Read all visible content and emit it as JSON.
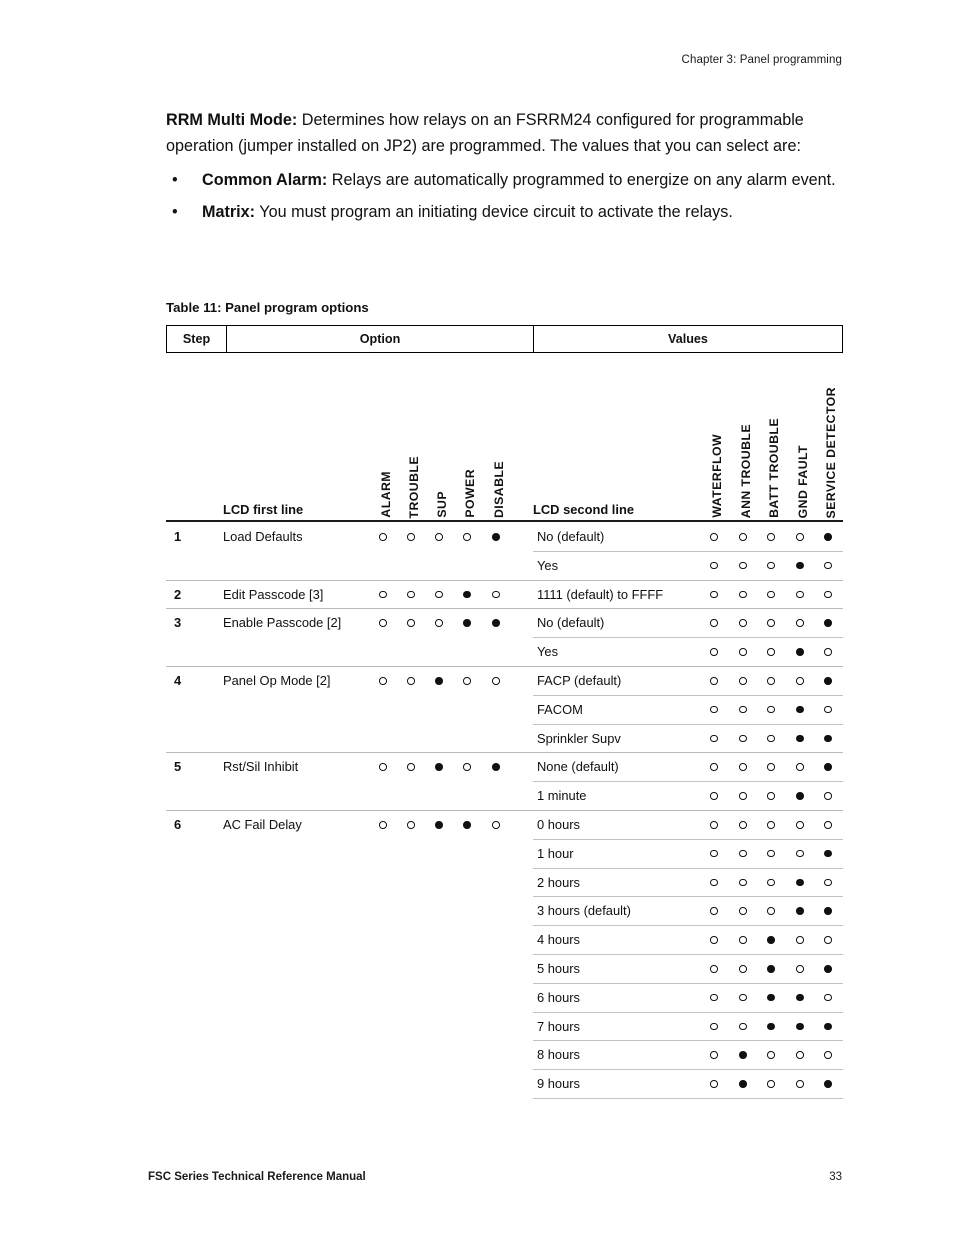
{
  "header": {
    "running_head": "Chapter 3: Panel programming"
  },
  "body": {
    "intro": {
      "lead": "RRM Multi Mode:",
      "text": " Determines how relays on an FSRRM24 configured for programmable operation (jumper installed on JP2) are programmed. The values that you can select are:"
    },
    "bullet_marker": "•",
    "bullets": [
      {
        "lead": "Common Alarm:",
        "text": " Relays are automatically programmed to energize on any alarm event."
      },
      {
        "lead": "Matrix:",
        "text": " You must program an initiating device circuit to activate the relays."
      }
    ]
  },
  "table": {
    "caption": "Table 11: Panel program options",
    "header": {
      "step": "Step",
      "option": "Option",
      "values": "Values"
    },
    "subheader": {
      "lcd_first": "LCD first line",
      "lcd_second": "LCD second line"
    },
    "option_bits": [
      "ALARM",
      "TROUBLE",
      "SUP",
      "POWER",
      "DISABLE"
    ],
    "value_bits": [
      "WATERFLOW",
      "ANN TROUBLE",
      "BATT TROUBLE",
      "GND FAULT",
      "SERVICE DETECTOR"
    ],
    "legend": {
      "open": "open circle (off)",
      "filled": "filled circle (on)"
    },
    "groups": [
      {
        "step": "1",
        "option": "Load Defaults",
        "option_leds": [
          0,
          0,
          0,
          0,
          1
        ],
        "values": [
          {
            "label": "No (default)",
            "leds": [
              0,
              0,
              0,
              0,
              1
            ]
          },
          {
            "label": "Yes",
            "leds": [
              0,
              0,
              0,
              1,
              0
            ]
          }
        ]
      },
      {
        "step": "2",
        "option": "Edit Passcode [3]",
        "option_leds": [
          0,
          0,
          0,
          1,
          0
        ],
        "values": [
          {
            "label": "1111 (default) to FFFF",
            "leds": [
              0,
              0,
              0,
              0,
              0
            ]
          }
        ]
      },
      {
        "step": "3",
        "option": "Enable Passcode [2]",
        "option_leds": [
          0,
          0,
          0,
          1,
          1
        ],
        "values": [
          {
            "label": "No (default)",
            "leds": [
              0,
              0,
              0,
              0,
              1
            ]
          },
          {
            "label": "Yes",
            "leds": [
              0,
              0,
              0,
              1,
              0
            ]
          }
        ]
      },
      {
        "step": "4",
        "option": "Panel Op Mode [2]",
        "option_leds": [
          0,
          0,
          1,
          0,
          0
        ],
        "values": [
          {
            "label": "FACP (default)",
            "leds": [
              0,
              0,
              0,
              0,
              1
            ]
          },
          {
            "label": "FACOM",
            "leds": [
              0,
              0,
              0,
              1,
              0
            ]
          },
          {
            "label": "Sprinkler Supv",
            "leds": [
              0,
              0,
              0,
              1,
              1
            ]
          }
        ]
      },
      {
        "step": "5",
        "option": "Rst/Sil Inhibit",
        "option_leds": [
          0,
          0,
          1,
          0,
          1
        ],
        "values": [
          {
            "label": "None (default)",
            "leds": [
              0,
              0,
              0,
              0,
              1
            ]
          },
          {
            "label": "1 minute",
            "leds": [
              0,
              0,
              0,
              1,
              0
            ]
          }
        ]
      },
      {
        "step": "6",
        "option": "AC Fail Delay",
        "option_leds": [
          0,
          0,
          1,
          1,
          0
        ],
        "values": [
          {
            "label": "0 hours",
            "leds": [
              0,
              0,
              0,
              0,
              0
            ]
          },
          {
            "label": "1 hour",
            "leds": [
              0,
              0,
              0,
              0,
              1
            ]
          },
          {
            "label": "2 hours",
            "leds": [
              0,
              0,
              0,
              1,
              0
            ]
          },
          {
            "label": "3 hours (default)",
            "leds": [
              0,
              0,
              0,
              1,
              1
            ]
          },
          {
            "label": "4 hours",
            "leds": [
              0,
              0,
              1,
              0,
              0
            ]
          },
          {
            "label": "5 hours",
            "leds": [
              0,
              0,
              1,
              0,
              1
            ]
          },
          {
            "label": "6 hours",
            "leds": [
              0,
              0,
              1,
              1,
              0
            ]
          },
          {
            "label": "7 hours",
            "leds": [
              0,
              0,
              1,
              1,
              1
            ]
          },
          {
            "label": "8 hours",
            "leds": [
              0,
              1,
              0,
              0,
              0
            ]
          },
          {
            "label": "9 hours",
            "leds": [
              0,
              1,
              0,
              0,
              1
            ]
          }
        ]
      }
    ]
  },
  "footer": {
    "manual": "FSC Series Technical Reference Manual",
    "page": "33"
  }
}
